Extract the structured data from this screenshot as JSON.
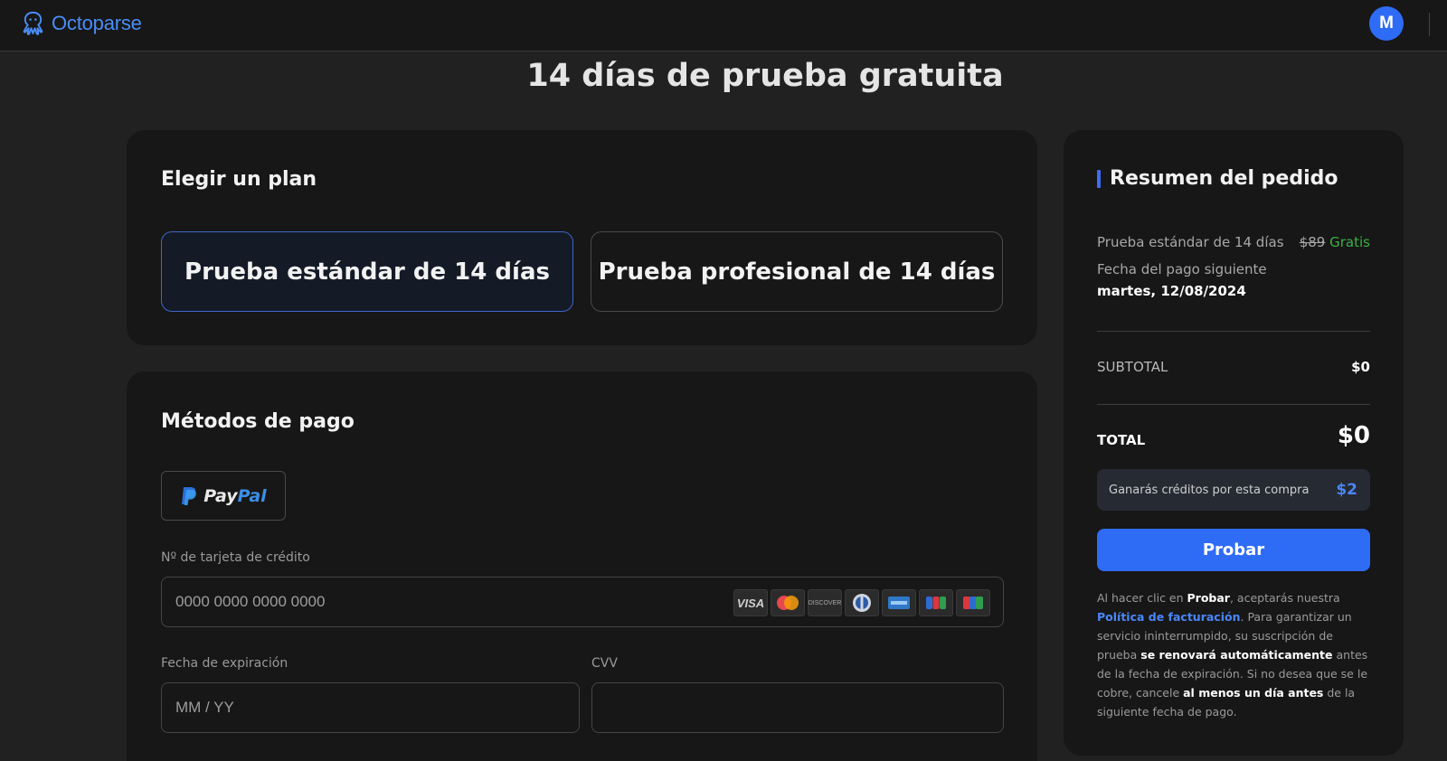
{
  "header": {
    "brand": "Octoparse",
    "avatar_initial": "M"
  },
  "page": {
    "title": "14 días de prueba gratuita"
  },
  "plan": {
    "heading": "Elegir un plan",
    "options": [
      {
        "label": "Prueba estándar de 14 días",
        "selected": true
      },
      {
        "label": "Prueba profesional de 14 días",
        "selected": false
      }
    ]
  },
  "payment": {
    "heading": "Métodos de pago",
    "paypal": {
      "pay": "Pay",
      "pal": "Pal"
    },
    "card_number": {
      "label": "Nº de tarjeta de crédito",
      "placeholder": "0000 0000 0000 0000"
    },
    "card_brands": [
      "VISA",
      "mastercard-icon",
      "DISCOVER",
      "diners-icon",
      "amex-icon",
      "jcb-icon",
      "unionpay-icon"
    ],
    "expiry": {
      "label": "Fecha de expiración",
      "placeholder": "MM / YY"
    },
    "cvv": {
      "label": "CVV",
      "placeholder": ""
    }
  },
  "summary": {
    "heading": "Resumen del pedido",
    "item_name": "Prueba estándar de 14 días",
    "item_old_price": "$89",
    "item_free": "Gratis",
    "next_payment_label": "Fecha del pago siguiente",
    "next_payment_date": "martes, 12/08/2024",
    "subtotal_label": "SUBTOTAL",
    "subtotal_value": "$0",
    "total_label": "TOTAL",
    "total_value": "$0",
    "credits_text": "Ganarás créditos por esta compra",
    "credits_amount": "$2",
    "cta": "Probar",
    "legal": {
      "p1": "Al hacer clic en ",
      "b1": "Probar",
      "p2": ", aceptarás nuestra ",
      "link": "Política de facturación",
      "p3": ". Para garantizar un servicio ininterrumpido, su suscripción de prueba ",
      "b2": "se renovará automáticamente",
      "p4": " antes de la fecha de expiración. Si no desea que se le cobre, cancele ",
      "b3": "al menos un día antes",
      "p5": " de la siguiente fecha de pago."
    }
  },
  "colors": {
    "accent": "#2f6cf6",
    "link": "#4a86f7",
    "free_green": "#3cb043",
    "background": "#212121",
    "card": "#171717"
  }
}
